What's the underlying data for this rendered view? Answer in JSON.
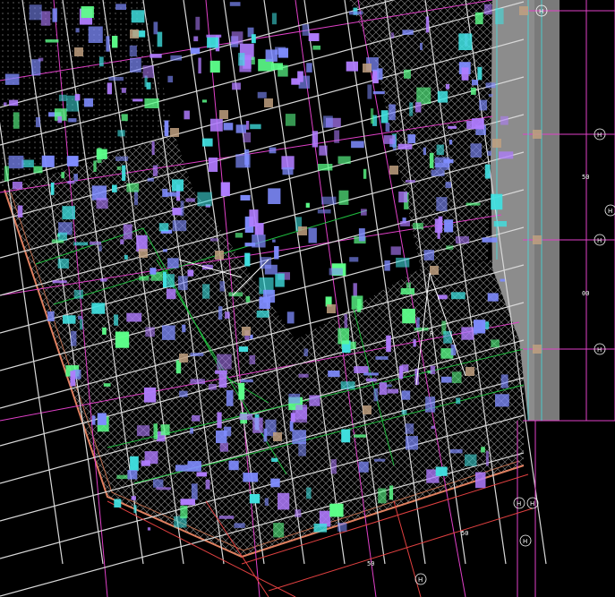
{
  "drawing": {
    "background": "#000000",
    "colors": {
      "grid_magenta": "#e040c8",
      "beam_white": "#d8d8d8",
      "hatch": "#9a9a9a",
      "column_tan": "#c0a080",
      "wall_gray": "#8c8c8c",
      "label_blue": "#7f8cff",
      "label_violet": "#b07cff",
      "label_green": "#5cff8a",
      "cyan": "#40e0e0",
      "slab_green": "#1fbf3f",
      "dim_orange": "#e08060"
    },
    "axis_labels": [
      "H",
      "H",
      "H",
      "H",
      "H",
      "H",
      "H",
      "H",
      "H"
    ],
    "dimension_texts": [
      "50",
      "50",
      "50",
      "00"
    ],
    "annotations": [
      "R"
    ]
  }
}
